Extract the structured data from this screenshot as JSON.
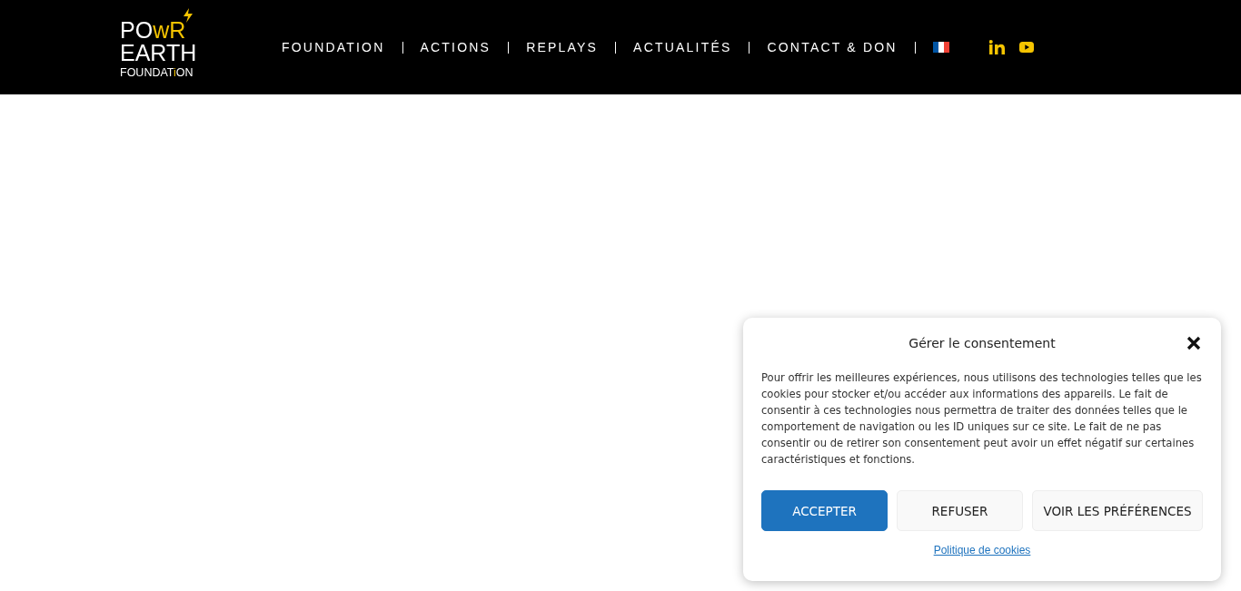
{
  "header": {
    "logo": [
      {
        "parts": [
          {
            "text": "PO",
            "accent": false
          },
          {
            "text": "wR",
            "accent": true
          }
        ]
      },
      {
        "parts": [
          {
            "text": "EARTH",
            "accent": false
          }
        ]
      },
      {
        "parts": [
          {
            "text": "FOUNDAT",
            "accent": false
          },
          {
            "text": "i",
            "accent": true
          },
          {
            "text": "ON",
            "accent": false
          }
        ]
      }
    ],
    "nav": [
      "FOUNDATION",
      "ACTIONS",
      "REPLAYS",
      "ACTUALITÉS",
      "CONTACT & DON"
    ]
  },
  "consent": {
    "title": "Gérer le consentement",
    "message": "Pour offrir les meilleures expériences, nous utilisons des technologies telles que les cookies pour stocker et/ou accéder aux informations des appareils. Le fait de consentir à ces technologies nous permettra de traiter des données telles que le comportement de navigation ou les ID uniques sur ce site. Le fait de ne pas consentir ou de retirer son consentement peut avoir un effet négatif sur certaines caractéristiques et fonctions.",
    "buttons": [
      {
        "label": "ACCEPTER",
        "kind": "primary"
      },
      {
        "label": "REFUSER",
        "kind": "secondary"
      },
      {
        "label": "VOIR LES PRÉFÉRENCES",
        "kind": "secondary"
      }
    ],
    "link": "Politique de cookies"
  }
}
